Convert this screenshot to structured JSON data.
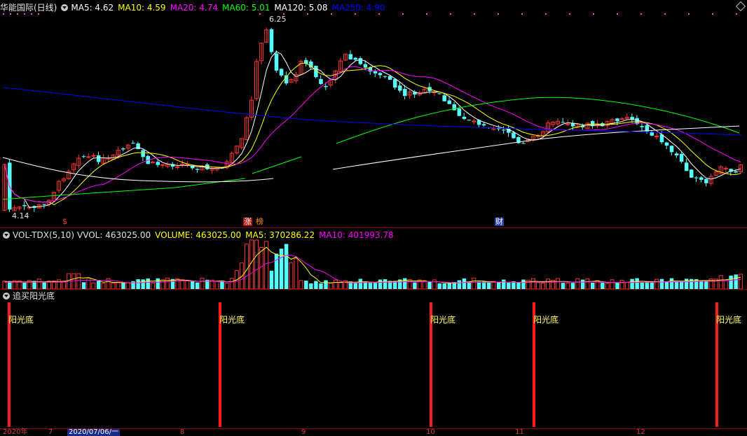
{
  "window": {
    "title": "华能国际(日线)"
  },
  "main_legend": {
    "items": [
      {
        "label": "MA5: 4.62",
        "color": "#ffffff"
      },
      {
        "label": "MA10: 4.59",
        "color": "#ffff00"
      },
      {
        "label": "MA20: 4.74",
        "color": "#ff00ff"
      },
      {
        "label": "MA60: 5.01",
        "color": "#00ff00"
      },
      {
        "label": "MA120: 5.08",
        "color": "#ffffff"
      },
      {
        "label": "MA250: 4.90",
        "color": "#0000ff"
      }
    ]
  },
  "price_annotations": {
    "high": "6.25",
    "low": "4.14"
  },
  "event_markers": {
    "m1": "$",
    "m2": "涨",
    "m3": "榜",
    "m4": "财"
  },
  "volume_legend": {
    "name": "VOL-TDX(5,10)",
    "vvol": "VVOL: 463025.00",
    "volume": "VOLUME: 463025.00",
    "ma5": "MA5: 370286.22",
    "ma10": "MA10: 401993.78"
  },
  "indicator": {
    "name": "追买阳光底",
    "signal_label": "阳光底",
    "signals": [
      {
        "label": "阳光底"
      },
      {
        "label": "阳光底"
      },
      {
        "label": "阳光底"
      },
      {
        "label": "阳光底"
      },
      {
        "label": "阳光底"
      }
    ]
  },
  "time_axis": {
    "labels": [
      "2020年",
      "7",
      "2020/07/06/一",
      "8",
      "9",
      "10",
      "11",
      "12"
    ]
  },
  "colors": {
    "up": "#ff3232",
    "down": "#54ffff",
    "ma5": "#ffffff",
    "ma10": "#ffff00",
    "ma20": "#ff00ff",
    "ma60": "#00ff00",
    "ma120": "#ffffff",
    "ma250": "#0000ff",
    "signal": "#ff1a1a",
    "signal_text": "#ffff66",
    "grid": "#8b0000"
  },
  "chart_data": {
    "type": "candlestick",
    "series": [
      {
        "name": "MA5",
        "values": [
          4.62
        ]
      },
      {
        "name": "MA10",
        "values": [
          4.59
        ]
      },
      {
        "name": "MA20",
        "values": [
          4.74
        ]
      },
      {
        "name": "MA60",
        "values": [
          5.01
        ]
      },
      {
        "name": "MA120",
        "values": [
          5.08
        ]
      },
      {
        "name": "MA250",
        "values": [
          4.9
        ]
      }
    ],
    "price_high": 6.25,
    "price_low": 4.14,
    "volume_last": 463025.0,
    "volume_ma5": 370286.22,
    "volume_ma10": 401993.78,
    "x_ticks": [
      "2020年",
      "7",
      "2020/07/06/一",
      "8",
      "9",
      "10",
      "11",
      "12"
    ]
  }
}
